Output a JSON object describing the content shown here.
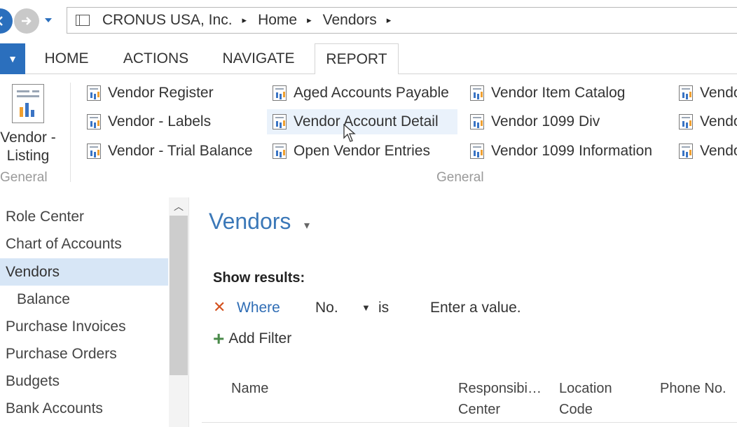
{
  "address": {
    "crumbs": [
      "CRONUS USA, Inc.",
      "Home",
      "Vendors"
    ],
    "separators": [
      "▸",
      "▸",
      "▸"
    ]
  },
  "tabs": {
    "home": "HOME",
    "actions": "ACTIONS",
    "navigate": "NAVIGATE",
    "report": "REPORT"
  },
  "ribbon": {
    "big_report": {
      "line1": "Vendor -",
      "line2": "Listing"
    },
    "group_left": "General",
    "group_right": "General",
    "reports": [
      "Vendor Register",
      "Vendor - Labels",
      "Vendor - Trial Balance",
      "Aged Accounts Payable",
      "Vendor Account Detail",
      "Open Vendor Entries",
      "Vendor Item Catalog",
      "Vendor 1099 Div",
      "Vendor 1099 Information",
      "Vendo",
      "Vendo",
      "Vendo"
    ]
  },
  "navpane": {
    "items": [
      "Role Center",
      "Chart of Accounts",
      "Vendors",
      "Balance",
      "Purchase Invoices",
      "Purchase Orders",
      "Budgets",
      "Bank Accounts"
    ]
  },
  "content": {
    "title": "Vendors",
    "show_results": "Show results:",
    "filter": {
      "where": "Where",
      "field": "No.",
      "operator": "is",
      "value": "Enter a value."
    },
    "add_filter": "Add Filter",
    "columns": {
      "name": "Name",
      "resp_1": "Responsibi…",
      "resp_2": "Center",
      "loc_1": "Location",
      "loc_2": "Code",
      "phone": "Phone No."
    }
  },
  "colors": {
    "accent": "#2b6fbd",
    "title": "#3b78b8",
    "active_nav": "#d7e6f6",
    "filter_remove": "#d4521f"
  }
}
